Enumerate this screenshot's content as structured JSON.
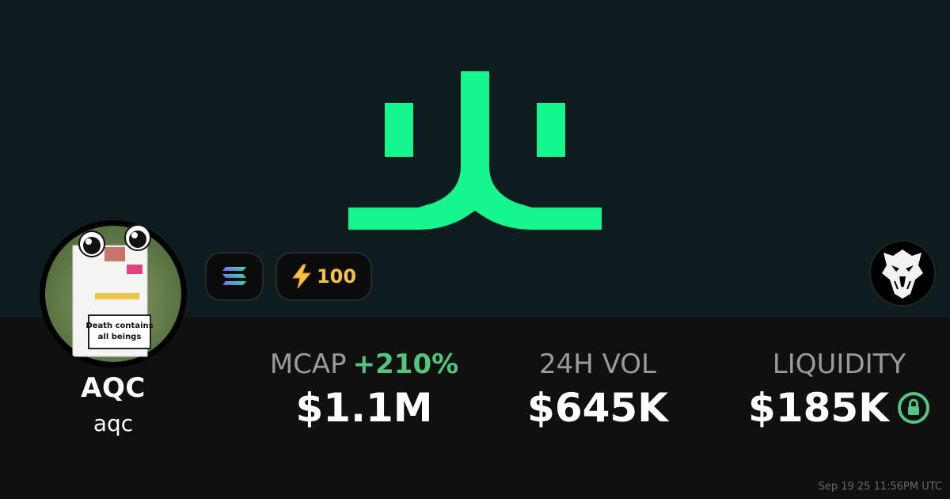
{
  "token": {
    "symbol": "AQC",
    "name": "aqc",
    "avatar_text": "Death contains all beings"
  },
  "badges": {
    "chain_icon": "solana-icon",
    "boost_icon": "lightning-icon",
    "boost_count": "100"
  },
  "stats": {
    "mcap": {
      "label": "MCAP",
      "change": "+210%",
      "value": "$1.1M"
    },
    "volume": {
      "label": "24H VOL",
      "value": "$645K"
    },
    "liquidity": {
      "label": "LIQUIDITY",
      "value": "$185K",
      "icon": "lock-icon"
    }
  },
  "timestamp": "Sep 19 25 11:56PM UTC",
  "colors": {
    "brand_green": "#16f68f",
    "top_background": "#0e1b1f",
    "bottom_background": "#101010",
    "positive_change": "#53c57e",
    "boost_yellow": "#f5c343"
  }
}
